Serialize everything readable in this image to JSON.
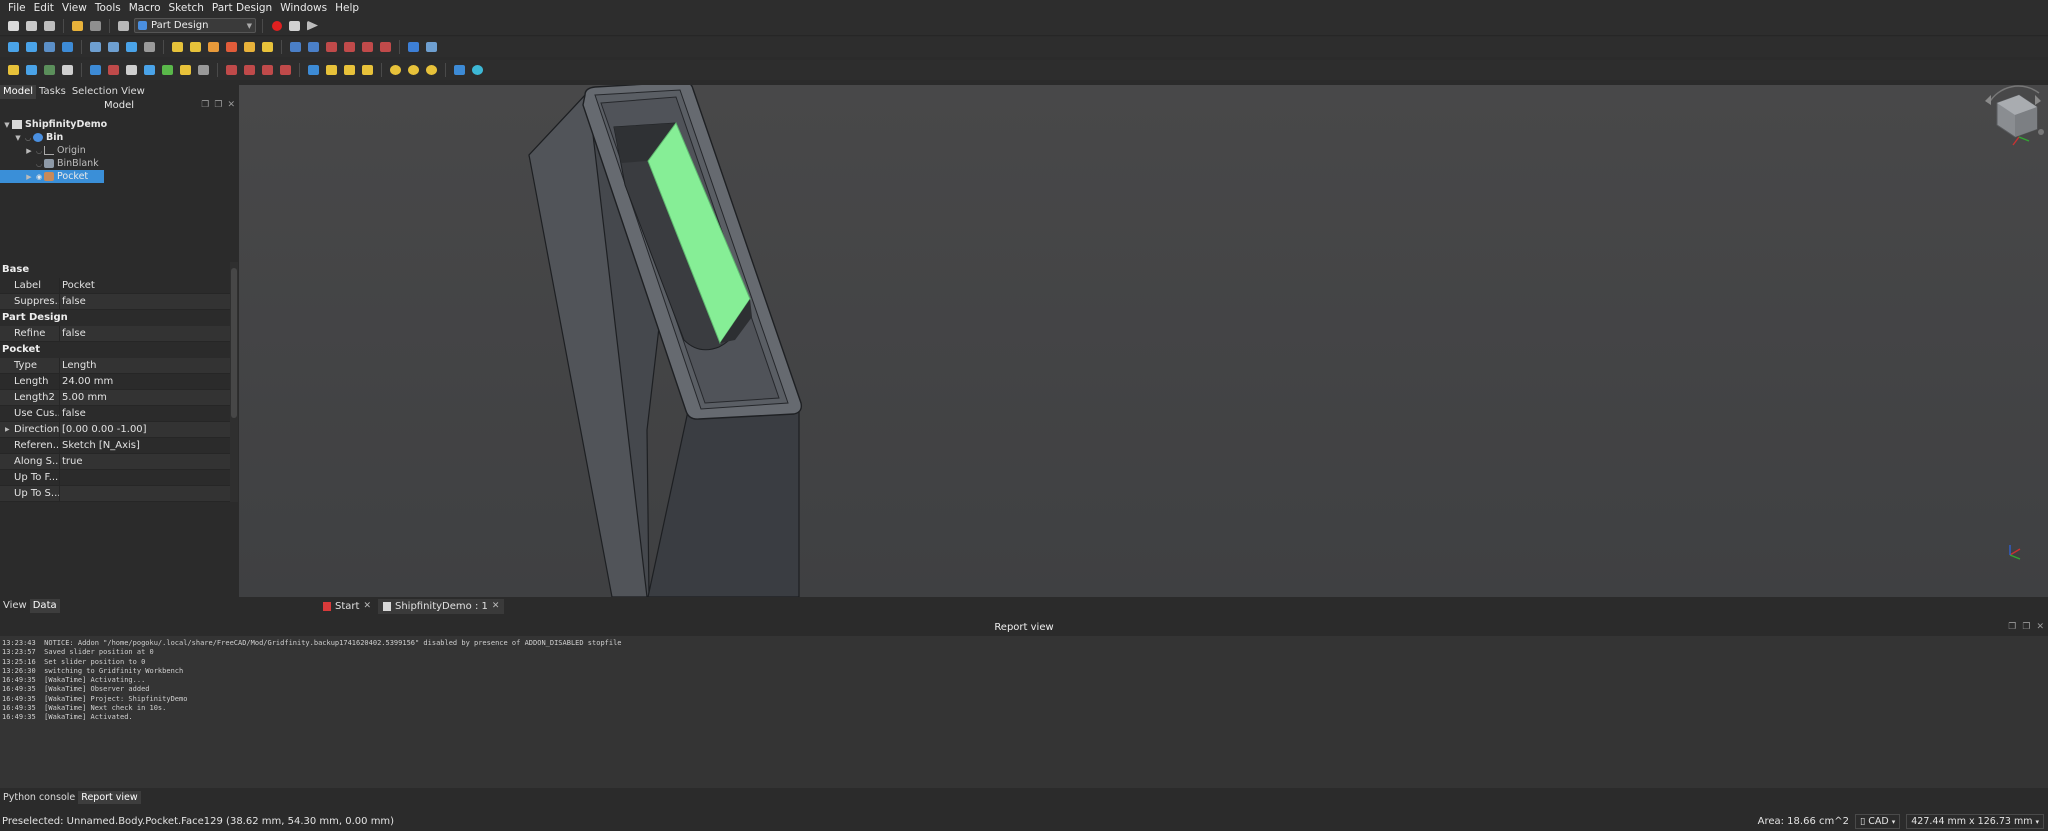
{
  "menu": [
    "File",
    "Edit",
    "View",
    "Tools",
    "Macro",
    "Sketch",
    "Part Design",
    "Windows",
    "Help"
  ],
  "workbench": {
    "selected": "Part Design"
  },
  "combo_view": {
    "tabs": [
      "Model",
      "Tasks",
      "Selection View"
    ],
    "header": "Model",
    "tree": [
      {
        "label": "ShipfinityDemo",
        "level": 0,
        "bold": true
      },
      {
        "label": "Bin",
        "level": 1,
        "bold": true
      },
      {
        "label": "Origin",
        "level": 2
      },
      {
        "label": "BinBlank",
        "level": 2
      },
      {
        "label": "Pocket",
        "level": 2,
        "selected": true
      }
    ]
  },
  "properties": {
    "groups": [
      {
        "name": "Base",
        "rows": [
          {
            "key": "Label",
            "value": "Pocket"
          },
          {
            "key": "Suppres...",
            "value": "false"
          }
        ]
      },
      {
        "name": "Part Design",
        "rows": [
          {
            "key": "Refine",
            "value": "false"
          }
        ]
      },
      {
        "name": "Pocket",
        "rows": [
          {
            "key": "Type",
            "value": "Length"
          },
          {
            "key": "Length",
            "value": "24.00 mm"
          },
          {
            "key": "Length2",
            "value": "5.00 mm"
          },
          {
            "key": "Use Cus...",
            "value": "false"
          },
          {
            "key": "Direction",
            "value": "[0.00 0.00 -1.00]",
            "expandable": true
          },
          {
            "key": "Referen...",
            "value": "Sketch [N_Axis]"
          },
          {
            "key": "Along S...",
            "value": "true"
          },
          {
            "key": "Up To F...",
            "value": ""
          },
          {
            "key": "Up To S...",
            "value": ""
          }
        ]
      }
    ],
    "tabs": [
      "View",
      "Data"
    ]
  },
  "doc_tabs": [
    "Start",
    "ShipfinityDemo : 1"
  ],
  "report": {
    "title": "Report view",
    "lines": [
      "13:23:43  NOTICE: Addon \"/home/pogoku/.local/share/FreeCAD/Mod/Gridfinity.backup1741620402.5399156\" disabled by presence of ADDON_DISABLED stopfile",
      "13:23:57  Saved slider position at 0",
      "13:25:16  Set slider position to 0",
      "13:26:30  switching to Gridfinity Workbench",
      "16:49:35  [WakaTime] Activating...",
      "16:49:35  [WakaTime] Observer added",
      "16:49:35  [WakaTime] Project: ShipfinityDemo",
      "16:49:35  [WakaTime] Next check in 10s.",
      "16:49:35  [WakaTime] Activated."
    ]
  },
  "bottom_tabs": [
    "Python console",
    "Report view"
  ],
  "status": {
    "message": "Preselected: Unnamed.Body.Pocket.Face129 (38.62 mm, 54.30 mm, 0.00 mm)",
    "area": "Area: 18.66 cm^2",
    "nav_style": "CAD",
    "dimensions": "427.44 mm x 126.73 mm"
  },
  "colors": {
    "selection": "#3a8fd8",
    "face_highlight": "#86ee96",
    "body": "#5c6066"
  }
}
